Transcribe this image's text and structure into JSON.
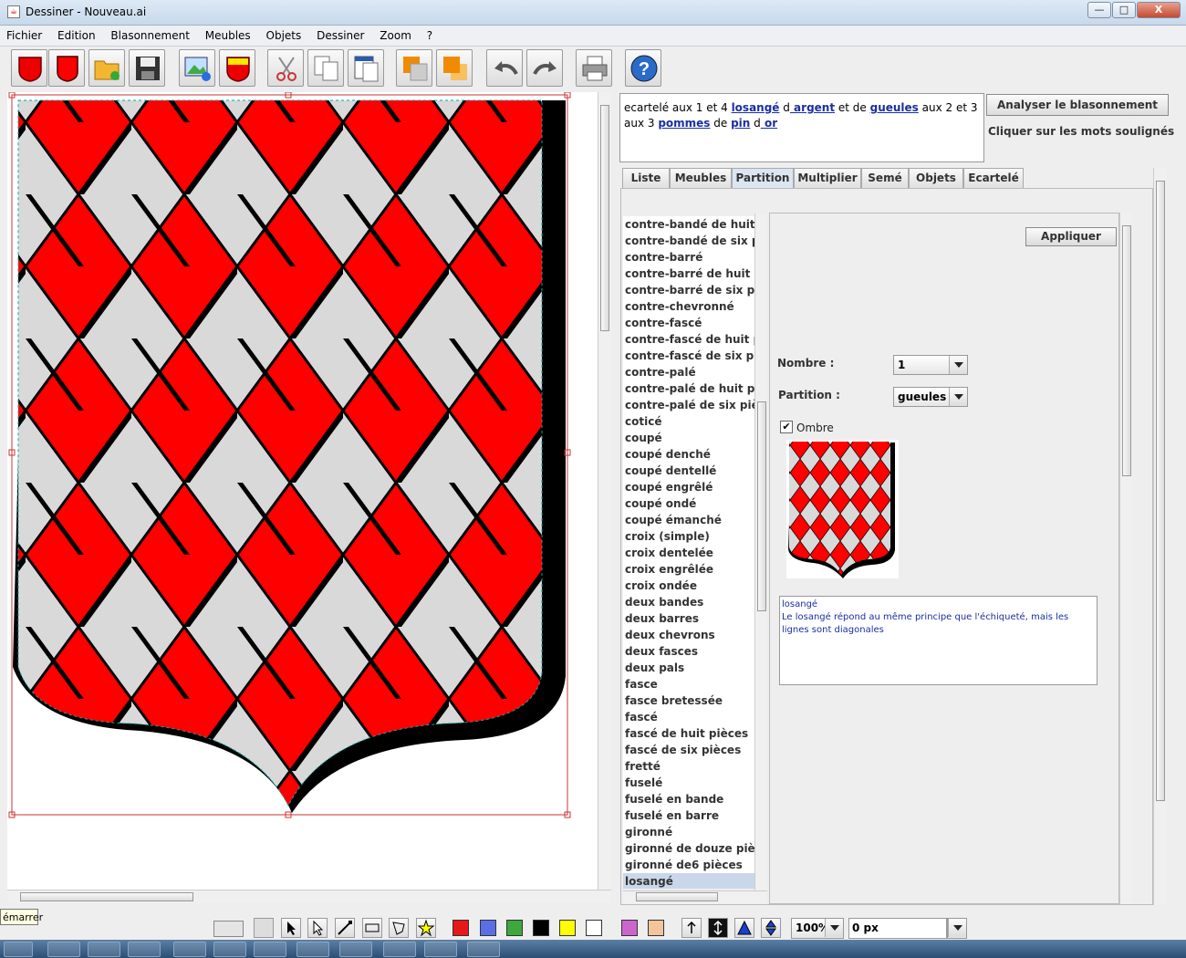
{
  "window": {
    "title": "Dessiner - Nouveau.ai",
    "minimize": "—",
    "maximize": "□",
    "close": "X"
  },
  "menu": [
    "Fichier",
    "Edition",
    "Blasonnement",
    "Meubles",
    "Objets",
    "Dessiner",
    "Zoom",
    "?"
  ],
  "toolbar_icons": [
    "shield-red-icon",
    "shield-red-flat-icon",
    "open-folder-icon",
    "save-icon",
    "image-add-icon",
    "shield-chief-icon",
    "scissors-icon",
    "copy-icon",
    "paste-icon",
    "front-icon",
    "back-icon",
    "undo-icon",
    "redo-icon",
    "print-icon",
    "help-icon"
  ],
  "blazon": {
    "parts": [
      {
        "text": "ecartelé aux 1 et 4 ",
        "link": false
      },
      {
        "text": "losangé",
        "link": true
      },
      {
        "text": " d",
        "link": false
      },
      {
        "text": " argent",
        "link": true
      },
      {
        "text": " et de ",
        "link": false
      },
      {
        "text": " gueules",
        "link": true
      },
      {
        "text": " aux 2 et 3 aux 3 ",
        "link": false
      },
      {
        "text": "pommes",
        "link": true
      },
      {
        "text": " de ",
        "link": false
      },
      {
        "text": "pin",
        "link": true
      },
      {
        "text": " d",
        "link": false
      },
      {
        "text": " or",
        "link": true
      }
    ]
  },
  "analyze_button": "Analyser le blasonnement",
  "hint": "Cliquer sur les mots soulignés",
  "tabs": [
    {
      "label": "Liste",
      "active": false
    },
    {
      "label": "Meubles",
      "active": false
    },
    {
      "label": "Partition",
      "active": true
    },
    {
      "label": "Multiplier",
      "active": false
    },
    {
      "label": "Semé",
      "active": false
    },
    {
      "label": "Objets",
      "active": false
    },
    {
      "label": "Ecartelé",
      "active": false
    }
  ],
  "partition_list": [
    "contre-bandé de huit pièces",
    "contre-bandé de six pièces",
    "contre-barré",
    "contre-barré de huit pièces",
    "contre-barré de six pièces",
    "contre-chevronné",
    "contre-fascé",
    "contre-fascé de huit pièces",
    "contre-fascé de six pièces",
    "contre-palé",
    "contre-palé de huit pièces",
    "contre-palé de six pièces",
    "coticé",
    "coupé",
    "coupé denché",
    "coupé dentellé",
    "coupé engrêlé",
    "coupé ondé",
    "coupé émanché",
    "croix (simple)",
    "croix dentelée",
    "croix engrêlée",
    "croix ondée",
    "deux bandes",
    "deux barres",
    "deux chevrons",
    "deux fasces",
    "deux pals",
    "fasce",
    "fasce bretessée",
    "fascé",
    "fascé de huit pièces",
    "fascé de six pièces",
    "fretté",
    "fuselé",
    "fuselé en bande",
    "fuselé en barre",
    "gironné",
    "gironné de douze pièces",
    "gironné de6 pièces",
    "losangé"
  ],
  "selected_item": "losangé",
  "apply_button": "Appliquer",
  "nombre": {
    "label": "Nombre :",
    "value": "1"
  },
  "partition": {
    "label": "Partition :",
    "value": "gueules"
  },
  "ombre": {
    "label": "Ombre",
    "checked": true,
    "check_mark": "✔"
  },
  "description": {
    "title": "losangé",
    "text": "Le losangé répond au même principe que l'échiqueté, mais les lignes sont diagonales"
  },
  "colors": {
    "gueules": "#ff0000",
    "argent": "#d9d9d9",
    "shadow": "#000000",
    "link": "#1a2fa0"
  },
  "palette": [
    "#e81818",
    "#5a6ee8",
    "#3ea83e",
    "#000000",
    "#ffff00",
    "#ffffff",
    "#cc66cc",
    "#f4c49c"
  ],
  "zoom": "100%",
  "stroke_width": "0 px",
  "tooltip": "émarrer"
}
